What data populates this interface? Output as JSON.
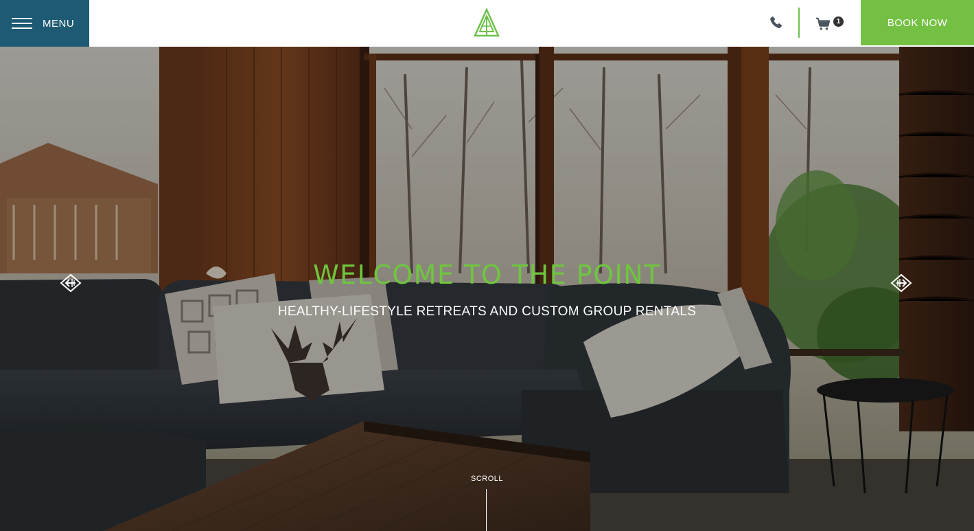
{
  "header": {
    "menu_label": "MENU",
    "cart_count": "1",
    "book_label": "BOOK NOW"
  },
  "colors": {
    "menu_bg": "#1e5a73",
    "brand_green": "#74c043",
    "title_green": "#6ec63e",
    "header_bg": "#ffffff"
  },
  "icons": {
    "menu": "hamburger-icon",
    "logo": "pine-tree-logo",
    "phone": "phone-icon",
    "cart": "cart-icon",
    "prev": "arrow-left-icon",
    "next": "arrow-right-icon"
  },
  "hero": {
    "title": "WELCOME TO THE POINT",
    "subtitle": "HEALTHY-LIFESTYLE RETREATS AND CUSTOM GROUP RENTALS",
    "scroll_label": "SCROLL"
  }
}
